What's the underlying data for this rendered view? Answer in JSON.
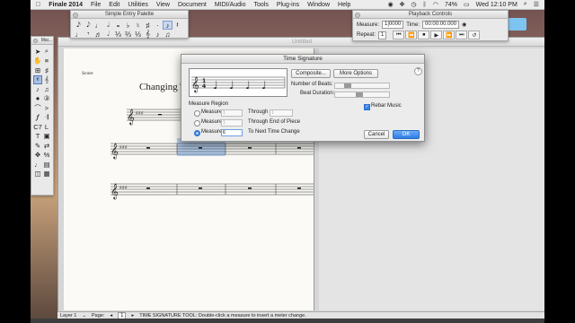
{
  "menubar": {
    "app_name": "Finale 2014",
    "items": [
      "File",
      "Edit",
      "Utilities",
      "View",
      "Document",
      "MIDI/Audio",
      "Tools",
      "Plug-ins",
      "Window",
      "Help"
    ],
    "battery": "74%",
    "clock": "Wed 12:10 PM"
  },
  "simple_palette": {
    "title": "Simple Entry Palette",
    "glyphs": [
      "𝅘𝅥𝅯",
      "𝅘𝅥𝅮",
      "♩",
      "𝅗𝅥",
      "𝅝",
      "♭",
      "♮",
      "♯",
      "·",
      "·",
      "♪",
      "𝄽",
      "♩",
      "𝄾",
      "♬",
      "𝆺𝅥",
      "⅓",
      "⅔",
      "⅓",
      "𝄞",
      "♪",
      "♫"
    ]
  },
  "main_tools": {
    "title": "Mai..."
  },
  "playback": {
    "title": "Playback Controls",
    "measure_label": "Measure:",
    "measure_value": "1|0000",
    "time_label": "Time:",
    "time_value": "00:00:00.000",
    "repeat_label": "Repeat:",
    "repeat_value": "1",
    "buttons": [
      "⏮",
      "⏪",
      "⏹",
      "▶",
      "⏩",
      "⏭",
      "↺"
    ]
  },
  "document": {
    "title": "Untitled",
    "score_label": "Score",
    "score_title": "Changing Ti"
  },
  "dialog": {
    "title": "Time Signature",
    "composite_label": "Composite...",
    "more_options_label": "More Options",
    "help_label": "?",
    "beats_label": "Number of Beats:",
    "duration_label": "Beat Duration:",
    "beats_value": 0.2,
    "duration_value": 0.45,
    "region_label": "Measure Region",
    "row1_label": "Measure",
    "row1_from": "1",
    "row1_mid": "Through",
    "row1_to": "1",
    "row2_label": "Measure",
    "row2_from": "1",
    "row2_mid": "Through End of Piece",
    "row3_label": "Measure",
    "row3_from": "6",
    "row3_mid": "To Next Time Change",
    "rebar_label": "Rebar Music",
    "cancel_label": "Cancel",
    "ok_label": "OK"
  },
  "status": {
    "layer_label": "Layer 1",
    "page_label": "Page:",
    "page_value": "1",
    "message": "TIME SIGNATURE TOOL: Double-click a measure to insert a meter change."
  }
}
